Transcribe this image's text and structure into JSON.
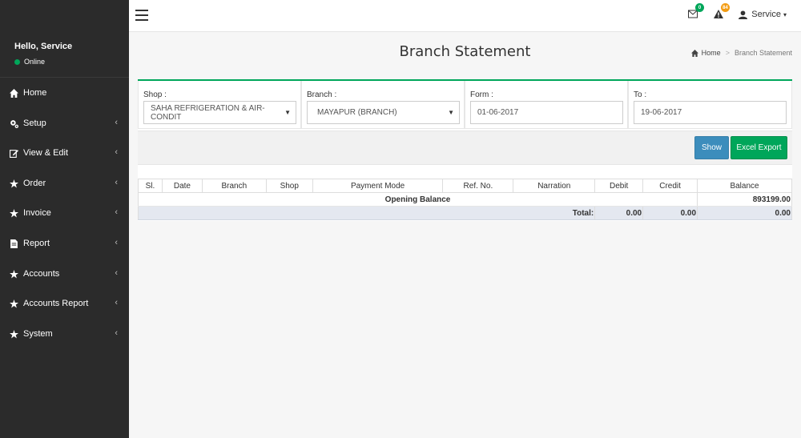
{
  "sidebar": {
    "greeting": "Hello, Service",
    "status": "Online",
    "items": [
      {
        "label": "Home",
        "icon": "home-icon",
        "has_arrow": false
      },
      {
        "label": "Setup",
        "icon": "cogs-icon",
        "has_arrow": true
      },
      {
        "label": "View & Edit",
        "icon": "edit-icon",
        "has_arrow": true
      },
      {
        "label": "Order",
        "icon": "star-icon",
        "has_arrow": true
      },
      {
        "label": "Invoice",
        "icon": "star-icon",
        "has_arrow": true
      },
      {
        "label": "Report",
        "icon": "file-icon",
        "has_arrow": true
      },
      {
        "label": "Accounts",
        "icon": "star-icon",
        "has_arrow": true
      },
      {
        "label": "Accounts Report",
        "icon": "star-icon",
        "has_arrow": true
      },
      {
        "label": "System",
        "icon": "star-icon",
        "has_arrow": true
      }
    ],
    "arrow": "‹"
  },
  "topbar": {
    "mail_badge": "0",
    "alert_badge": "84",
    "user_label": "Service",
    "user_caret": "▾"
  },
  "header": {
    "title": "Branch Statement",
    "breadcrumb_home": "Home",
    "breadcrumb_sep": ">",
    "breadcrumb_current": "Branch Statement"
  },
  "filters": {
    "shop_label": "Shop :",
    "shop_value": "SAHA REFRIGERATION & AIR-CONDIT",
    "branch_label": "Branch :",
    "branch_value": "MAYAPUR (BRANCH)",
    "from_label": "Form :",
    "from_value": "01-06-2017",
    "to_label": "To :",
    "to_value": "19-06-2017",
    "caret": "▼"
  },
  "buttons": {
    "show": "Show",
    "excel": "Excel Export"
  },
  "table": {
    "headers": [
      "Sl.",
      "Date",
      "Branch",
      "Shop",
      "Payment Mode",
      "Ref. No.",
      "Narration",
      "Debit",
      "Credit",
      "Balance"
    ],
    "opening_label": "Opening Balance",
    "opening_value": "893199.00",
    "total_label": "Total:",
    "total_debit": "0.00",
    "total_credit": "0.00",
    "total_balance": "0.00"
  },
  "colors": {
    "sidebar_bg": "#2b2b2b",
    "accent_green": "#00a65a",
    "primary_blue": "#3c8dbc",
    "badge_green": "#00a65a",
    "badge_orange": "#f39c12"
  }
}
